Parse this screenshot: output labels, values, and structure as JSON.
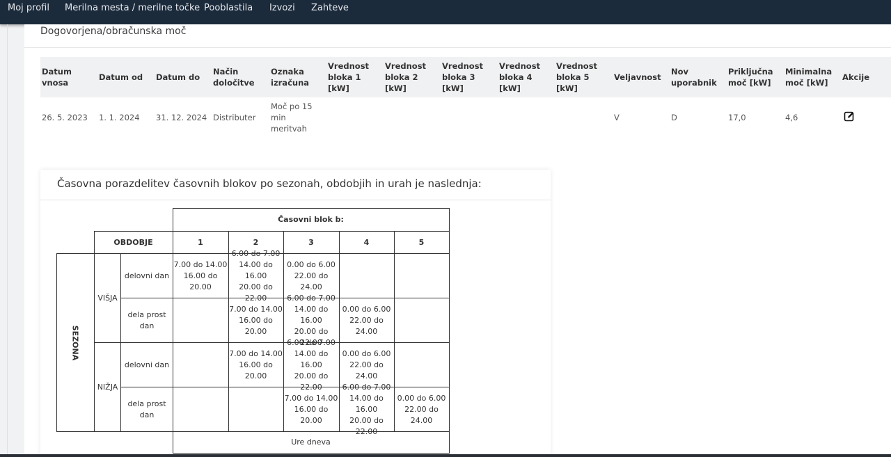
{
  "nav": {
    "items": [
      "Moj profil",
      "Merilna mesta / merilne točke",
      "Pooblastila",
      "Izvozi",
      "Zahteve"
    ]
  },
  "section": {
    "title": "Dogovorjena/obračunska moč"
  },
  "table": {
    "headers": [
      "Datum\nvnosa",
      "Datum od",
      "Datum do",
      "Način\ndoločitve",
      "Oznaka\nizračuna",
      "Vrednost\nbloka 1\n[kW]",
      "Vrednost\nbloka 2\n[kW]",
      "Vrednost\nbloka 3\n[kW]",
      "Vrednost\nbloka 4\n[kW]",
      "Vrednost\nbloka 5\n[kW]",
      "Veljavnost",
      "Nov\nuporabnik",
      "Priključna\nmoč [kW]",
      "Minimalna\nmoč [kW]",
      "Akcije"
    ],
    "row": [
      "26. 5. 2023",
      "1. 1. 2024",
      "31. 12. 2024",
      "Distributer",
      "Moč po 15\nmin\nmeritvah",
      "",
      "",
      "",
      "",
      "",
      "V",
      "D",
      "17,0",
      "4,6"
    ],
    "action_icon": "edit-icon"
  },
  "card": {
    "title": "Časovna porazdelitev časovnih blokov po sezonah, obdobjih in urah je naslednja:",
    "block_header": "Časovni blok b:",
    "period_header": "OBDOBJE",
    "block_numbers": [
      "1",
      "2",
      "3",
      "4",
      "5"
    ],
    "season_label": "SEZONA",
    "seasons": [
      "VIŠJA",
      "NIŽJA"
    ],
    "day_types": [
      "delovni dan",
      "dela prost dan",
      "delovni dan",
      "dela prost dan"
    ],
    "cells": [
      [
        "7.00 do 14.00\n16.00 do 20.00",
        "6.00 do 7.00\n14.00 do 16.00\n20.00 do 22.00",
        "0.00 do 6.00\n22.00 do 24.00",
        "",
        ""
      ],
      [
        "",
        "7.00 do 14.00\n16.00 do 20.00",
        "6.00 do 7.00\n14.00 do 16.00\n20.00 do 22.00",
        "0.00 do 6.00\n22.00 do 24.00",
        ""
      ],
      [
        "",
        "7.00 do 14.00\n16.00 do 20.00",
        "6.00 do 7.00\n14.00 do 16.00\n20.00 do 22.00",
        "0.00 do 6.00\n22.00 do 24.00",
        ""
      ],
      [
        "",
        "",
        "7.00 do 14.00\n16.00 do 20.00",
        "6.00 do 7.00\n14.00 do 16.00\n20.00 do 22.00",
        "0.00 do 6.00\n22.00 do 24.00"
      ]
    ],
    "footer": "Ure dneva"
  }
}
